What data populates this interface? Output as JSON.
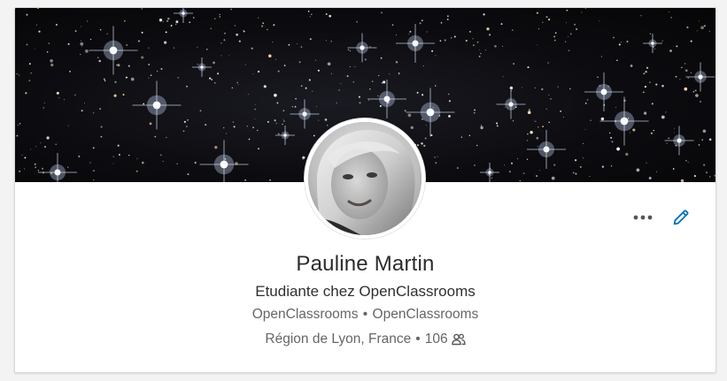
{
  "profile": {
    "name": "Pauline Martin",
    "headline": "Etudiante chez OpenClassrooms",
    "company_primary": "OpenClassrooms",
    "company_secondary": "OpenClassrooms",
    "separator": "•",
    "location": "Région de Lyon, France",
    "connections": "106"
  },
  "icons": {
    "more": "more-horizontal-icon",
    "edit": "pencil-icon",
    "connections": "people-icon"
  },
  "colors": {
    "accent": "#0073b1",
    "banner": "#0b0b0f",
    "text_primary": "#2b2b2b",
    "text_secondary": "#666666"
  }
}
